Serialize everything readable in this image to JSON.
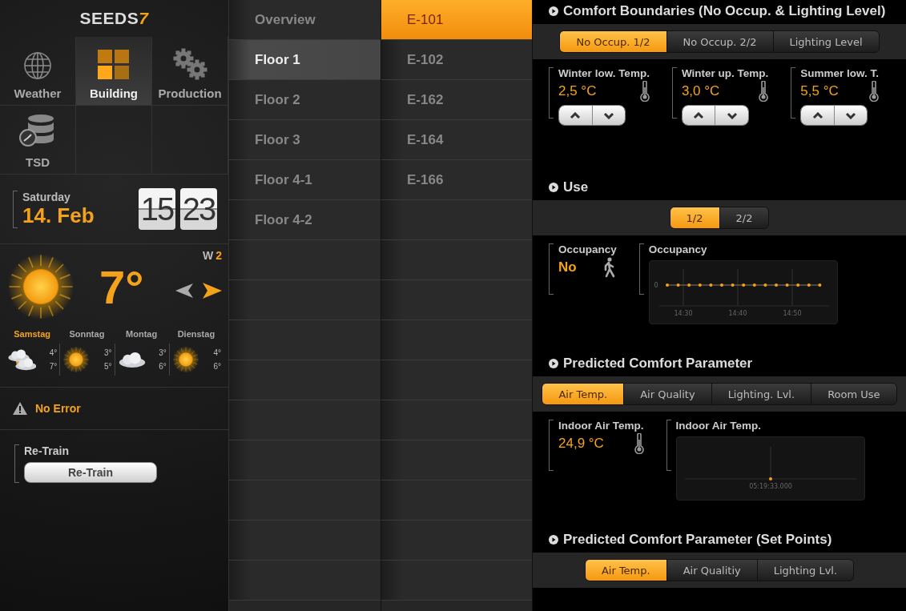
{
  "sidebar": {
    "logo": {
      "text": "SEEDS",
      "mark": "7"
    },
    "nav_tiles": [
      {
        "label": "Weather",
        "selected": false
      },
      {
        "label": "Building",
        "selected": true
      },
      {
        "label": "Production",
        "selected": false
      },
      {
        "label": "TSD",
        "selected": false
      }
    ],
    "date": {
      "weekday": "Saturday",
      "day": "14. Feb"
    },
    "clock": {
      "hours": "15",
      "minutes": "23"
    },
    "weather": {
      "temperature": "7°",
      "wind_label": "W",
      "wind_value": "2",
      "forecast": [
        {
          "day": "Samstag",
          "selected": true,
          "kind": "partly-cloudy",
          "upper": "4°",
          "lower": "7°"
        },
        {
          "day": "Sonntag",
          "selected": false,
          "kind": "sunny",
          "upper": "3°",
          "lower": "5°"
        },
        {
          "day": "Montag",
          "selected": false,
          "kind": "cloudy",
          "upper": "3°",
          "lower": "6°"
        },
        {
          "day": "Dienstag",
          "selected": false,
          "kind": "sunny",
          "upper": "4°",
          "lower": "6°"
        }
      ]
    },
    "status": {
      "text": "No Error"
    },
    "retrain": {
      "label": "Re-Train",
      "button": "Re-Train"
    }
  },
  "floors": [
    {
      "label": "Overview",
      "selected": false
    },
    {
      "label": "Floor 1",
      "selected": true
    },
    {
      "label": "Floor 2",
      "selected": false
    },
    {
      "label": "Floor 3",
      "selected": false
    },
    {
      "label": "Floor 4-1",
      "selected": false
    },
    {
      "label": "Floor 4-2",
      "selected": false
    }
  ],
  "rooms": [
    {
      "label": "E-101",
      "selected": true
    },
    {
      "label": "E-102",
      "selected": false
    },
    {
      "label": "E-162",
      "selected": false
    },
    {
      "label": "E-164",
      "selected": false
    },
    {
      "label": "E-166",
      "selected": false
    }
  ],
  "details": {
    "sections": [
      {
        "title": "Comfort Boundaries (No Occup. & Lighting Level)",
        "tabs": [
          {
            "label": "No Occup. 1/2",
            "selected": true
          },
          {
            "label": "No Occup. 2/2",
            "selected": false
          },
          {
            "label": "Lighting Level",
            "selected": false
          }
        ],
        "fields": [
          {
            "kind": "stepper",
            "label": "Winter low. Temp.",
            "value": "2,5 °C"
          },
          {
            "kind": "stepper",
            "label": "Winter up. Temp.",
            "value": "3,0 °C"
          },
          {
            "kind": "stepper",
            "label": "Summer low. T.",
            "value": "5,5 °C"
          }
        ]
      },
      {
        "title": "Use",
        "tabs": [
          {
            "label": "1/2",
            "selected": true
          },
          {
            "label": "2/2",
            "selected": false
          }
        ],
        "fields": [
          {
            "kind": "occupancy",
            "label": "Occupancy",
            "value": "No"
          }
        ],
        "chart": {
          "label": "Occupancy",
          "kind": "flat-line",
          "y_tick_label": "0",
          "tick_labels": [
            "14:30",
            "14:40",
            "14:50"
          ]
        }
      },
      {
        "title": "Predicted Comfort Parameter",
        "tabs": [
          {
            "label": "Air Temp.",
            "selected": true
          },
          {
            "label": "Air Quality",
            "selected": false
          },
          {
            "label": "Lighting. Lvl.",
            "selected": false
          },
          {
            "label": "Room Use",
            "selected": false
          }
        ],
        "fields": [
          {
            "kind": "reading",
            "label": "Indoor Air Temp.",
            "value": "24,9 °C"
          }
        ],
        "chart": {
          "label": "Indoor Air Temp.",
          "kind": "single-point",
          "tick_labels": [
            "05:19:33.000"
          ]
        }
      },
      {
        "title": "Predicted Comfort Parameter (Set Points)",
        "tabs": [
          {
            "label": "Air Temp.",
            "selected": true
          },
          {
            "label": "Air Qualitiy",
            "selected": false
          },
          {
            "label": "Lighting Lvl.",
            "selected": false
          }
        ]
      }
    ]
  }
}
